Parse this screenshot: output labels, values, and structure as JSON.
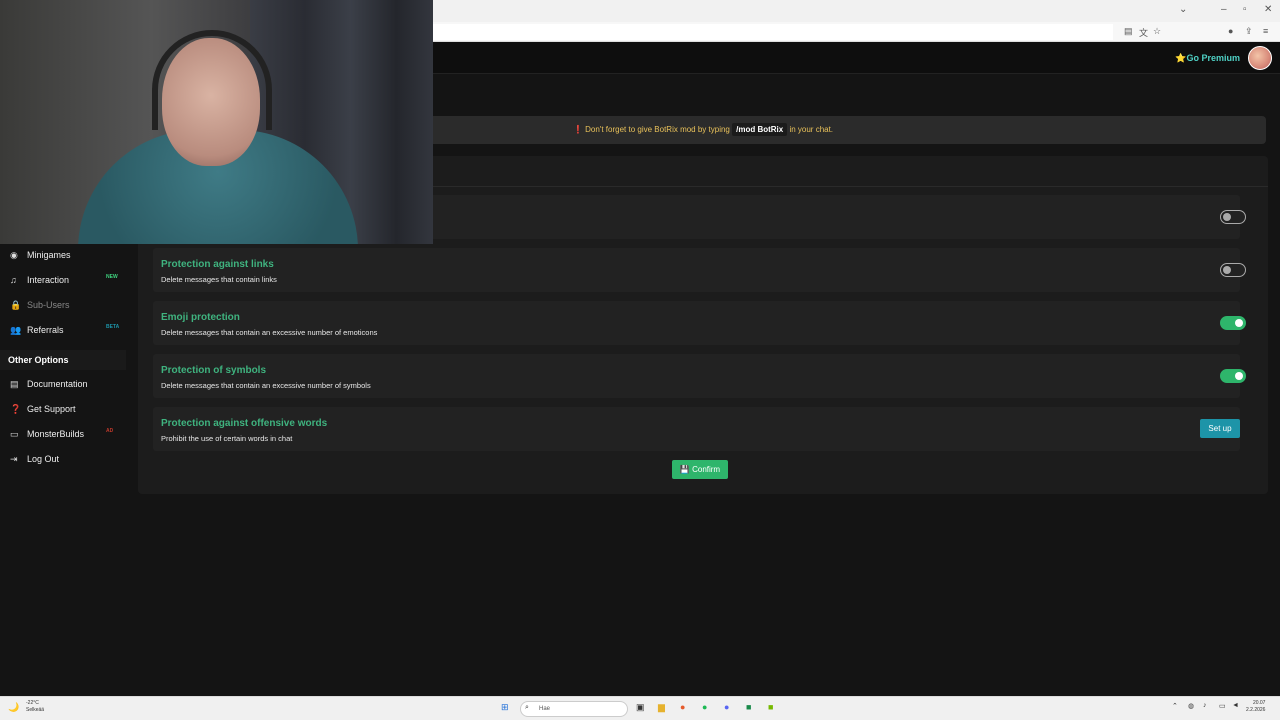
{
  "header": {
    "premium_label": "⭐Go Premium"
  },
  "notice": {
    "prefix": "Don't forget to give BotRix mod by typing",
    "code": "/mod BotRix",
    "suffix": "in your chat."
  },
  "sidebar": {
    "items": [
      {
        "label": "Minigames",
        "icon": "gamepad-icon",
        "badge": ""
      },
      {
        "label": "Interaction",
        "icon": "music-icon",
        "badge": "NEW"
      },
      {
        "label": "Sub-Users",
        "icon": "lock-icon",
        "badge": ""
      },
      {
        "label": "Referrals",
        "icon": "users-icon",
        "badge": "BETA"
      }
    ],
    "section_title": "Other Options",
    "options": [
      {
        "label": "Documentation",
        "icon": "document-icon"
      },
      {
        "label": "Get Support",
        "icon": "help-icon"
      },
      {
        "label": "MonsterBuilds",
        "icon": "monitor-icon",
        "badge": "AD"
      },
      {
        "label": "Log Out",
        "icon": "logout-icon"
      }
    ]
  },
  "settings": {
    "rows": [
      {
        "title": "Protection against links",
        "desc": "Delete messages that contain links",
        "enabled": false
      },
      {
        "title": "Emoji protection",
        "desc": "Delete messages that contain an excessive number of emoticons",
        "enabled": true
      },
      {
        "title": "Protection of symbols",
        "desc": "Delete messages that contain an excessive number of symbols",
        "enabled": true
      },
      {
        "title": "Protection against offensive words",
        "desc": "Prohibit the use of certain words in chat",
        "action": "Set up"
      }
    ],
    "top_toggle_enabled": false,
    "confirm_label": "Confirm"
  },
  "taskbar": {
    "weather_temp": "-22°C",
    "weather_text": "Selkeää",
    "search_placeholder": "Hae",
    "time": "20.07",
    "date": "2.2.2026"
  },
  "colors": {
    "accent_green": "#3fb37f",
    "toggle_on": "#2eb56b",
    "setup_button": "#1d94a8",
    "notice_text": "#e8c15a"
  }
}
